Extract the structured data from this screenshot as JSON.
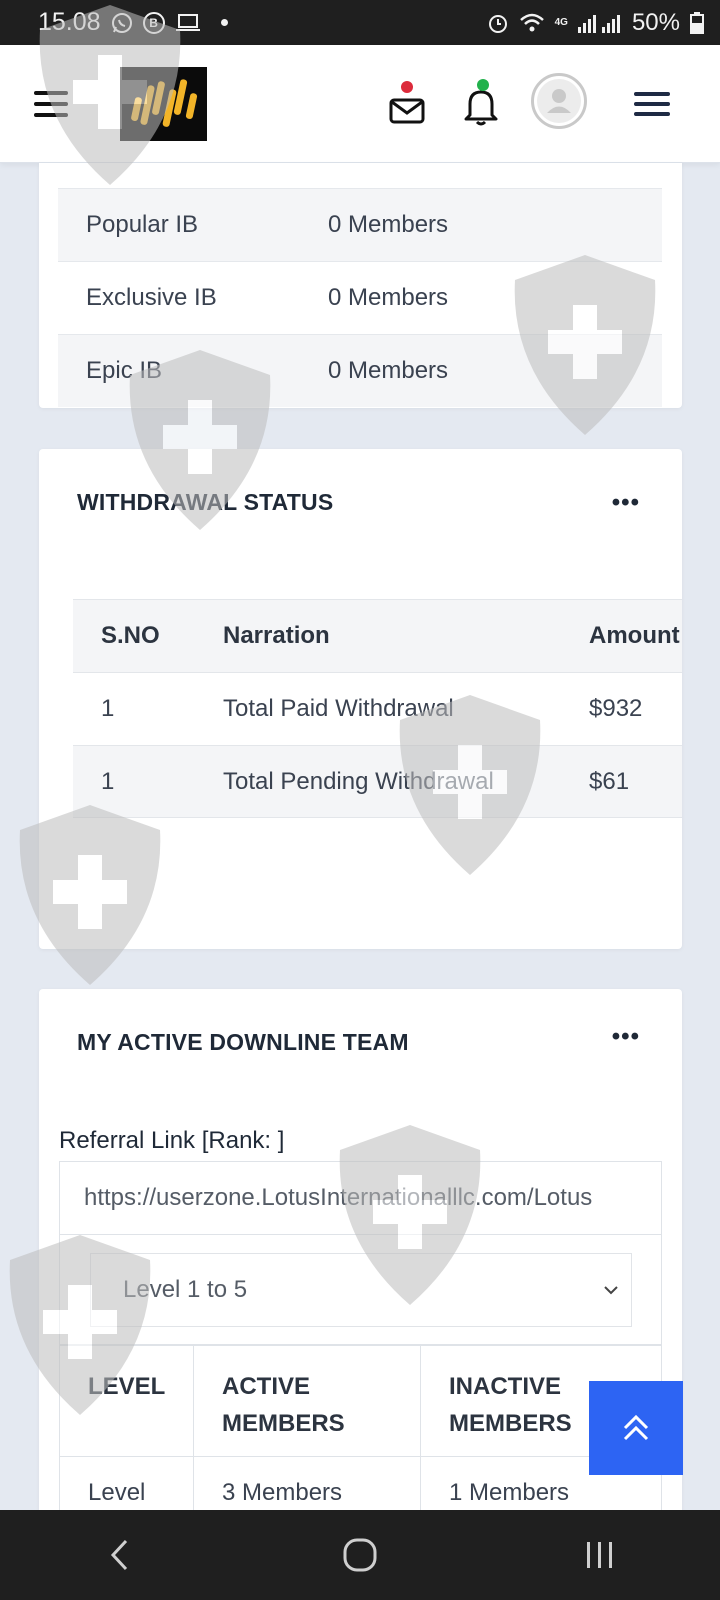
{
  "status_bar": {
    "time": "15.08",
    "battery": "50%",
    "network": "4G",
    "icons": [
      "whatsapp-icon",
      "b-icon",
      "laptop-icon",
      "alarm-icon",
      "wifi-icon",
      "signal-icon",
      "battery-icon"
    ]
  },
  "header": {
    "logo_icon": "logo-icon",
    "mail_badge_color": "#dc2b3b",
    "bell_badge_color": "#22b14c"
  },
  "ib_table": {
    "rows": [
      {
        "name": "Popular IB",
        "count": "0 Members"
      },
      {
        "name": "Exclusive IB",
        "count": "0 Members"
      },
      {
        "name": "Epic IB",
        "count": "0 Members"
      }
    ]
  },
  "withdrawal": {
    "title": "WITHDRAWAL STATUS",
    "menu": "•••",
    "headers": [
      "S.NO",
      "Narration",
      "Amount"
    ],
    "rows": [
      {
        "sno": "1",
        "narration": "Total Paid Withdrawal",
        "amount": "$932"
      },
      {
        "sno": "1",
        "narration": "Total Pending Withdrawal",
        "amount": "$61"
      }
    ]
  },
  "downline": {
    "title": "MY ACTIVE DOWNLINE TEAM",
    "menu": "•••",
    "referral_label": "Referral Link [Rank: ]",
    "referral_link": "https://userzone.LotusInternationalllc.com/Lotus",
    "level_select": "Level 1 to 5",
    "headers": {
      "level": "LEVEL",
      "active_line1": "ACTIVE",
      "active_line2": "MEMBERS",
      "inactive_line1": "INACTIVE",
      "inactive_line2": "MEMBERS"
    },
    "rows": [
      {
        "level": "Level",
        "active": "3 Members",
        "inactive": "1 Members"
      }
    ]
  },
  "colors": {
    "accent": "#2d64f3",
    "logo_gold": "#f2b428",
    "page_bg": "#e4e9f1"
  }
}
